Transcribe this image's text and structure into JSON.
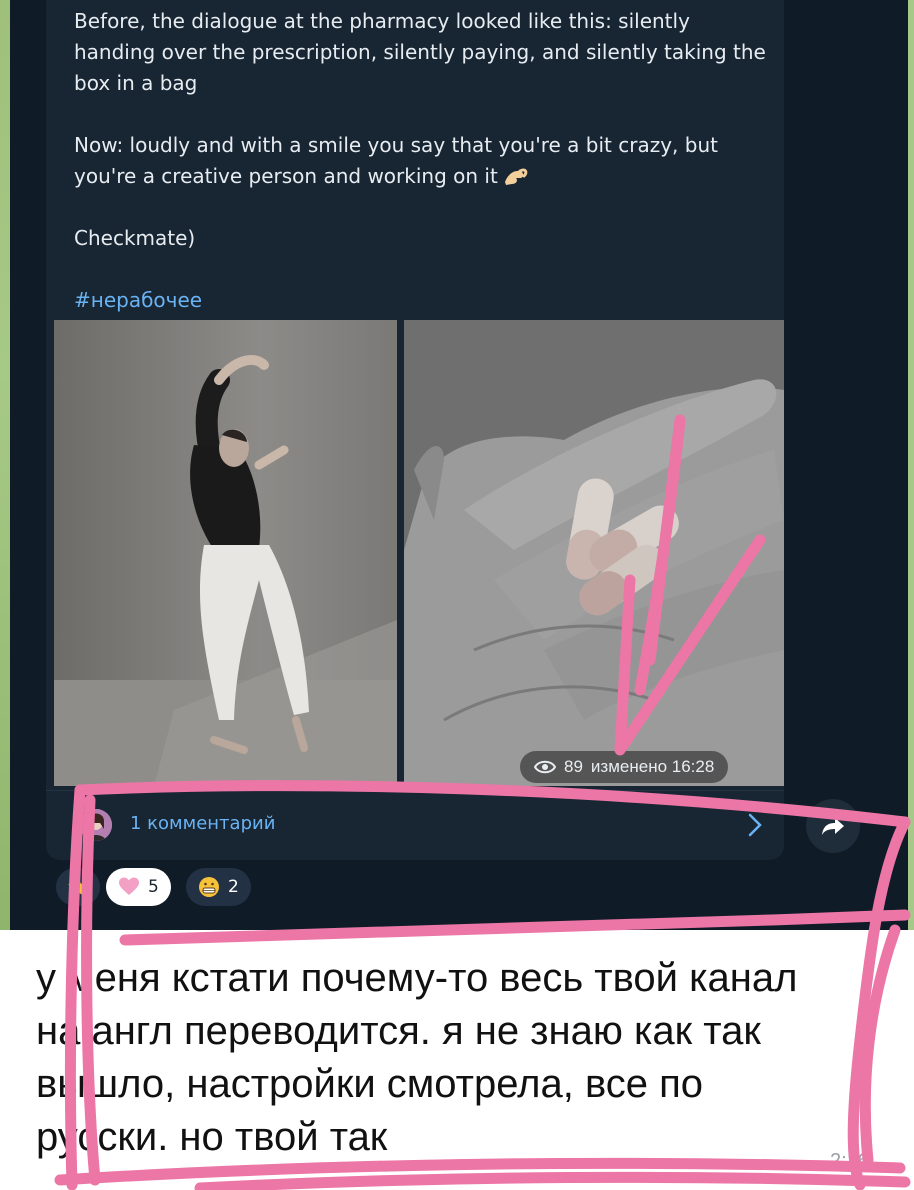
{
  "post": {
    "paragraph1_line1": "Before, the dialogue at the pharmacy looked like this: silently",
    "paragraph1_line2": "handing over the prescription, silently paying, and silently taking the",
    "paragraph1_line3": "box in a bag",
    "paragraph2_line1": "Now: loudly and with a smile you say that you're a bit crazy, but",
    "paragraph2_line2": "you're a creative person and working on it",
    "paragraph3": "Checkmate)",
    "hashtag": "#нерабочее"
  },
  "meta": {
    "views": "89",
    "edited": "изменено 16:28"
  },
  "comments": {
    "label": "1 комментарий"
  },
  "reactions": [
    {
      "icon": "star-icon",
      "count": ""
    },
    {
      "icon": "heart-icon",
      "count": "5"
    },
    {
      "icon": "grin-emoji-icon",
      "count": "2"
    }
  ],
  "reply": {
    "line1": "у меня кстати почему-то весь твой канал",
    "line2": "на англ переводится. я не знаю как так",
    "line3": "вышло, настройки смотрела, все по",
    "line4": "русски. но твой так",
    "time": "2:16"
  },
  "colors": {
    "dark_background": "#0f1b27",
    "bubble": "#182533",
    "link": "#6ab3f3",
    "annotation": "#ec76a6"
  }
}
